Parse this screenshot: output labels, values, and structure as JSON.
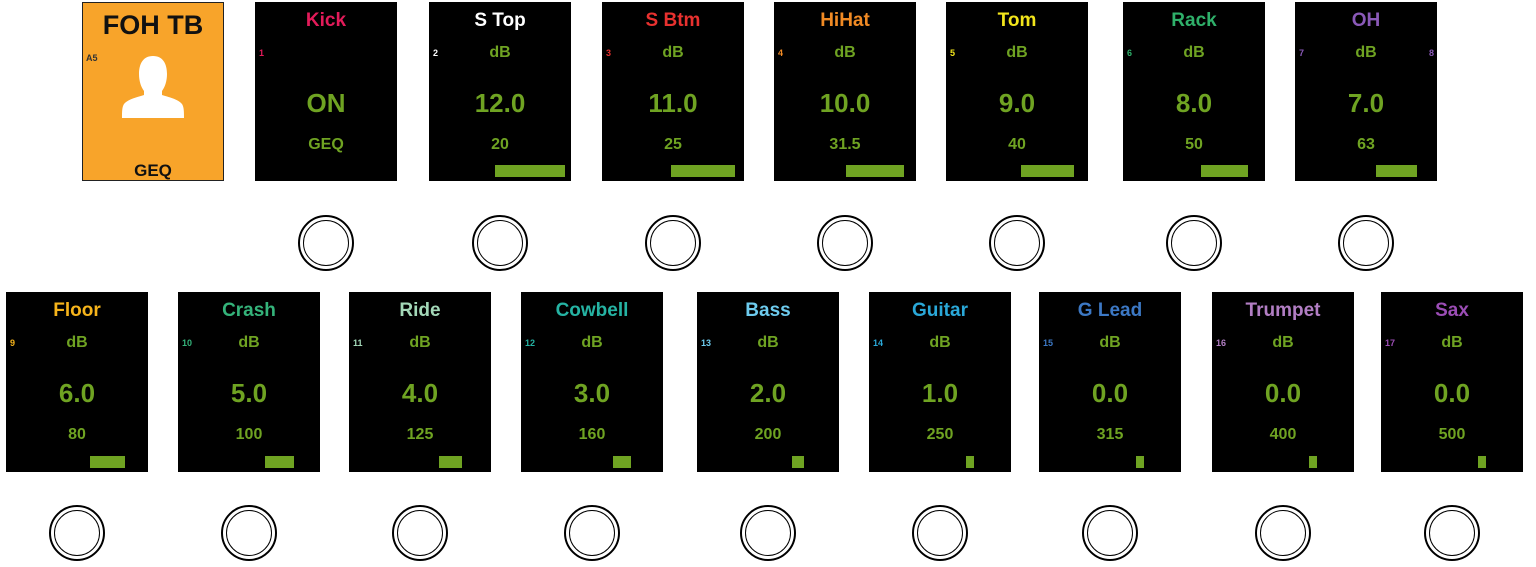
{
  "header_tile": {
    "title": "FOH TB",
    "slot": "A5",
    "label": "GEQ",
    "icon": "user-silhouette-icon",
    "bg_color": "#f8a42a"
  },
  "value_color": "#6fa322",
  "channels": [
    {
      "id": "kick",
      "name": "Kick",
      "num": "1",
      "name_color": "#e31b5a",
      "unit": "",
      "value": "ON",
      "freq": "GEQ",
      "level": null
    },
    {
      "id": "s-top",
      "name": "S Top",
      "num": "2",
      "name_color": "#ffffff",
      "unit": "dB",
      "value": "12.0",
      "freq": "20",
      "level": 1.0
    },
    {
      "id": "s-btm",
      "name": "S Btm",
      "num": "3",
      "name_color": "#e8312f",
      "unit": "dB",
      "value": "11.0",
      "freq": "25",
      "level": 0.917
    },
    {
      "id": "hihat",
      "name": "HiHat",
      "num": "4",
      "name_color": "#f08a24",
      "unit": "dB",
      "value": "10.0",
      "freq": "31.5",
      "level": 0.833
    },
    {
      "id": "tom",
      "name": "Tom",
      "num": "5",
      "name_color": "#f2e51b",
      "unit": "dB",
      "value": "9.0",
      "freq": "40",
      "level": 0.75
    },
    {
      "id": "rack",
      "name": "Rack",
      "num": "6",
      "name_color": "#2fb06a",
      "unit": "dB",
      "value": "8.0",
      "freq": "50",
      "level": 0.667
    },
    {
      "id": "oh",
      "name": "OH",
      "num": "7",
      "num_right": "8",
      "name_color": "#8a59b8",
      "unit": "dB",
      "value": "7.0",
      "freq": "63",
      "level": 0.583
    },
    {
      "id": "floor",
      "name": "Floor",
      "num": "9",
      "name_color": "#f6b41b",
      "unit": "dB",
      "value": "6.0",
      "freq": "80",
      "level": 0.5
    },
    {
      "id": "crash",
      "name": "Crash",
      "num": "10",
      "name_color": "#34b37a",
      "unit": "dB",
      "value": "5.0",
      "freq": "100",
      "level": 0.417
    },
    {
      "id": "ride",
      "name": "Ride",
      "num": "11",
      "name_color": "#a3d8b8",
      "unit": "dB",
      "value": "4.0",
      "freq": "125",
      "level": 0.333
    },
    {
      "id": "cowbell",
      "name": "Cowbell",
      "num": "12",
      "name_color": "#25b3a3",
      "unit": "dB",
      "value": "3.0",
      "freq": "160",
      "level": 0.25
    },
    {
      "id": "bass",
      "name": "Bass",
      "num": "13",
      "name_color": "#6dcbee",
      "unit": "dB",
      "value": "2.0",
      "freq": "200",
      "level": 0.167
    },
    {
      "id": "guitar",
      "name": "Guitar",
      "num": "14",
      "name_color": "#2aa8d8",
      "unit": "dB",
      "value": "1.0",
      "freq": "250",
      "level": 0.083
    },
    {
      "id": "g-lead",
      "name": "G Lead",
      "num": "15",
      "name_color": "#3c78c4",
      "unit": "dB",
      "value": "0.0",
      "freq": "315",
      "level": 0.06
    },
    {
      "id": "trumpet",
      "name": "Trumpet",
      "num": "16",
      "name_color": "#b27ec4",
      "unit": "dB",
      "value": "0.0",
      "freq": "400",
      "level": 0.06
    },
    {
      "id": "sax",
      "name": "Sax",
      "num": "17",
      "name_color": "#9b4db5",
      "unit": "dB",
      "value": "0.0",
      "freq": "500",
      "level": 0.06
    }
  ]
}
